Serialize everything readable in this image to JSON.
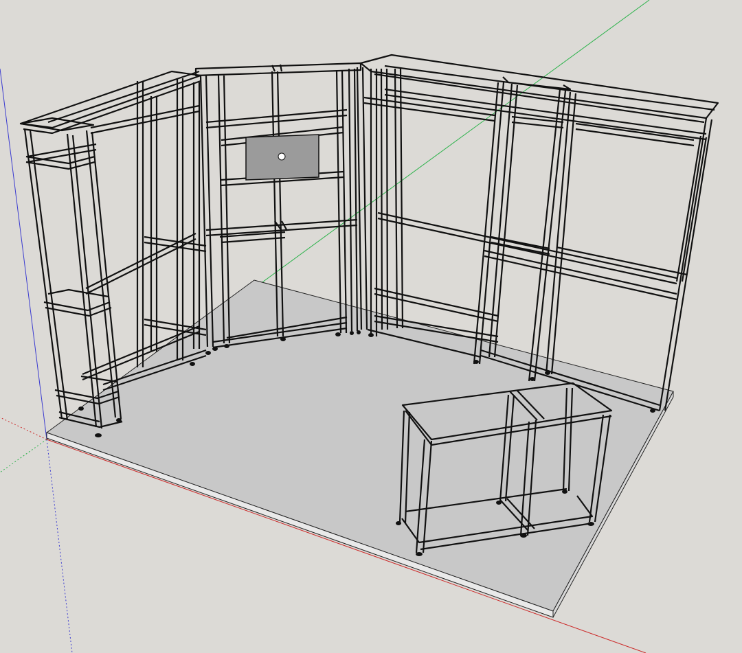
{
  "viewport": {
    "background_color": "#dcdad6",
    "floor_color": "#c8c8c8",
    "floor_edge_color": "#e9e9e9",
    "panel_color": "#9b9b9b",
    "axis_colors": {
      "red": "#cc2a2a",
      "green": "#2bb24a",
      "blue": "#3a3ad0"
    }
  },
  "scene": {
    "description_visible": false,
    "objects": [
      "trade-show-booth-frame",
      "counter-frame",
      "floor-platform",
      "display-panel"
    ]
  }
}
